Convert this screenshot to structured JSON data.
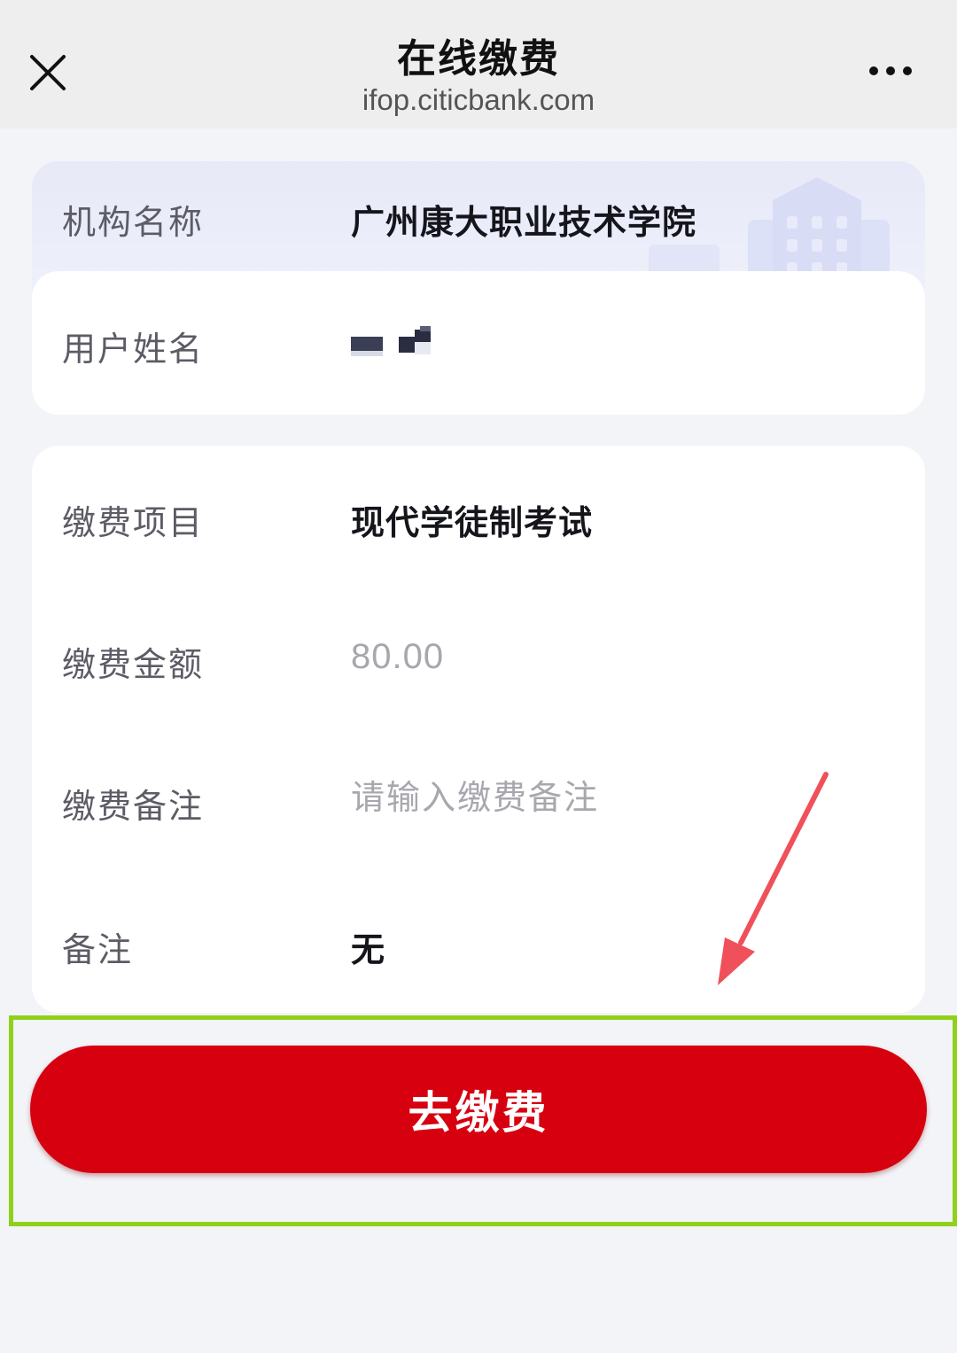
{
  "header": {
    "title": "在线缴费",
    "subtitle": "ifop.citicbank.com"
  },
  "institution": {
    "label": "机构名称",
    "value": "广州康大职业技术学院"
  },
  "user": {
    "label": "用户姓名"
  },
  "payment": {
    "item_label": "缴费项目",
    "item_value": "现代学徒制考试",
    "amount_label": "缴费金额",
    "amount_value": "80.00",
    "remark_label": "缴费备注",
    "remark_placeholder": "请输入缴费备注",
    "note_label": "备注",
    "note_value": "无"
  },
  "actions": {
    "pay_label": "去缴费"
  },
  "colors": {
    "primary_button": "#d6000f",
    "highlight_frame": "#8fd11a",
    "annotation_arrow": "#f0505a"
  },
  "icons": [
    "close-icon",
    "more-icon",
    "building-icon",
    "arrow-annotation"
  ]
}
